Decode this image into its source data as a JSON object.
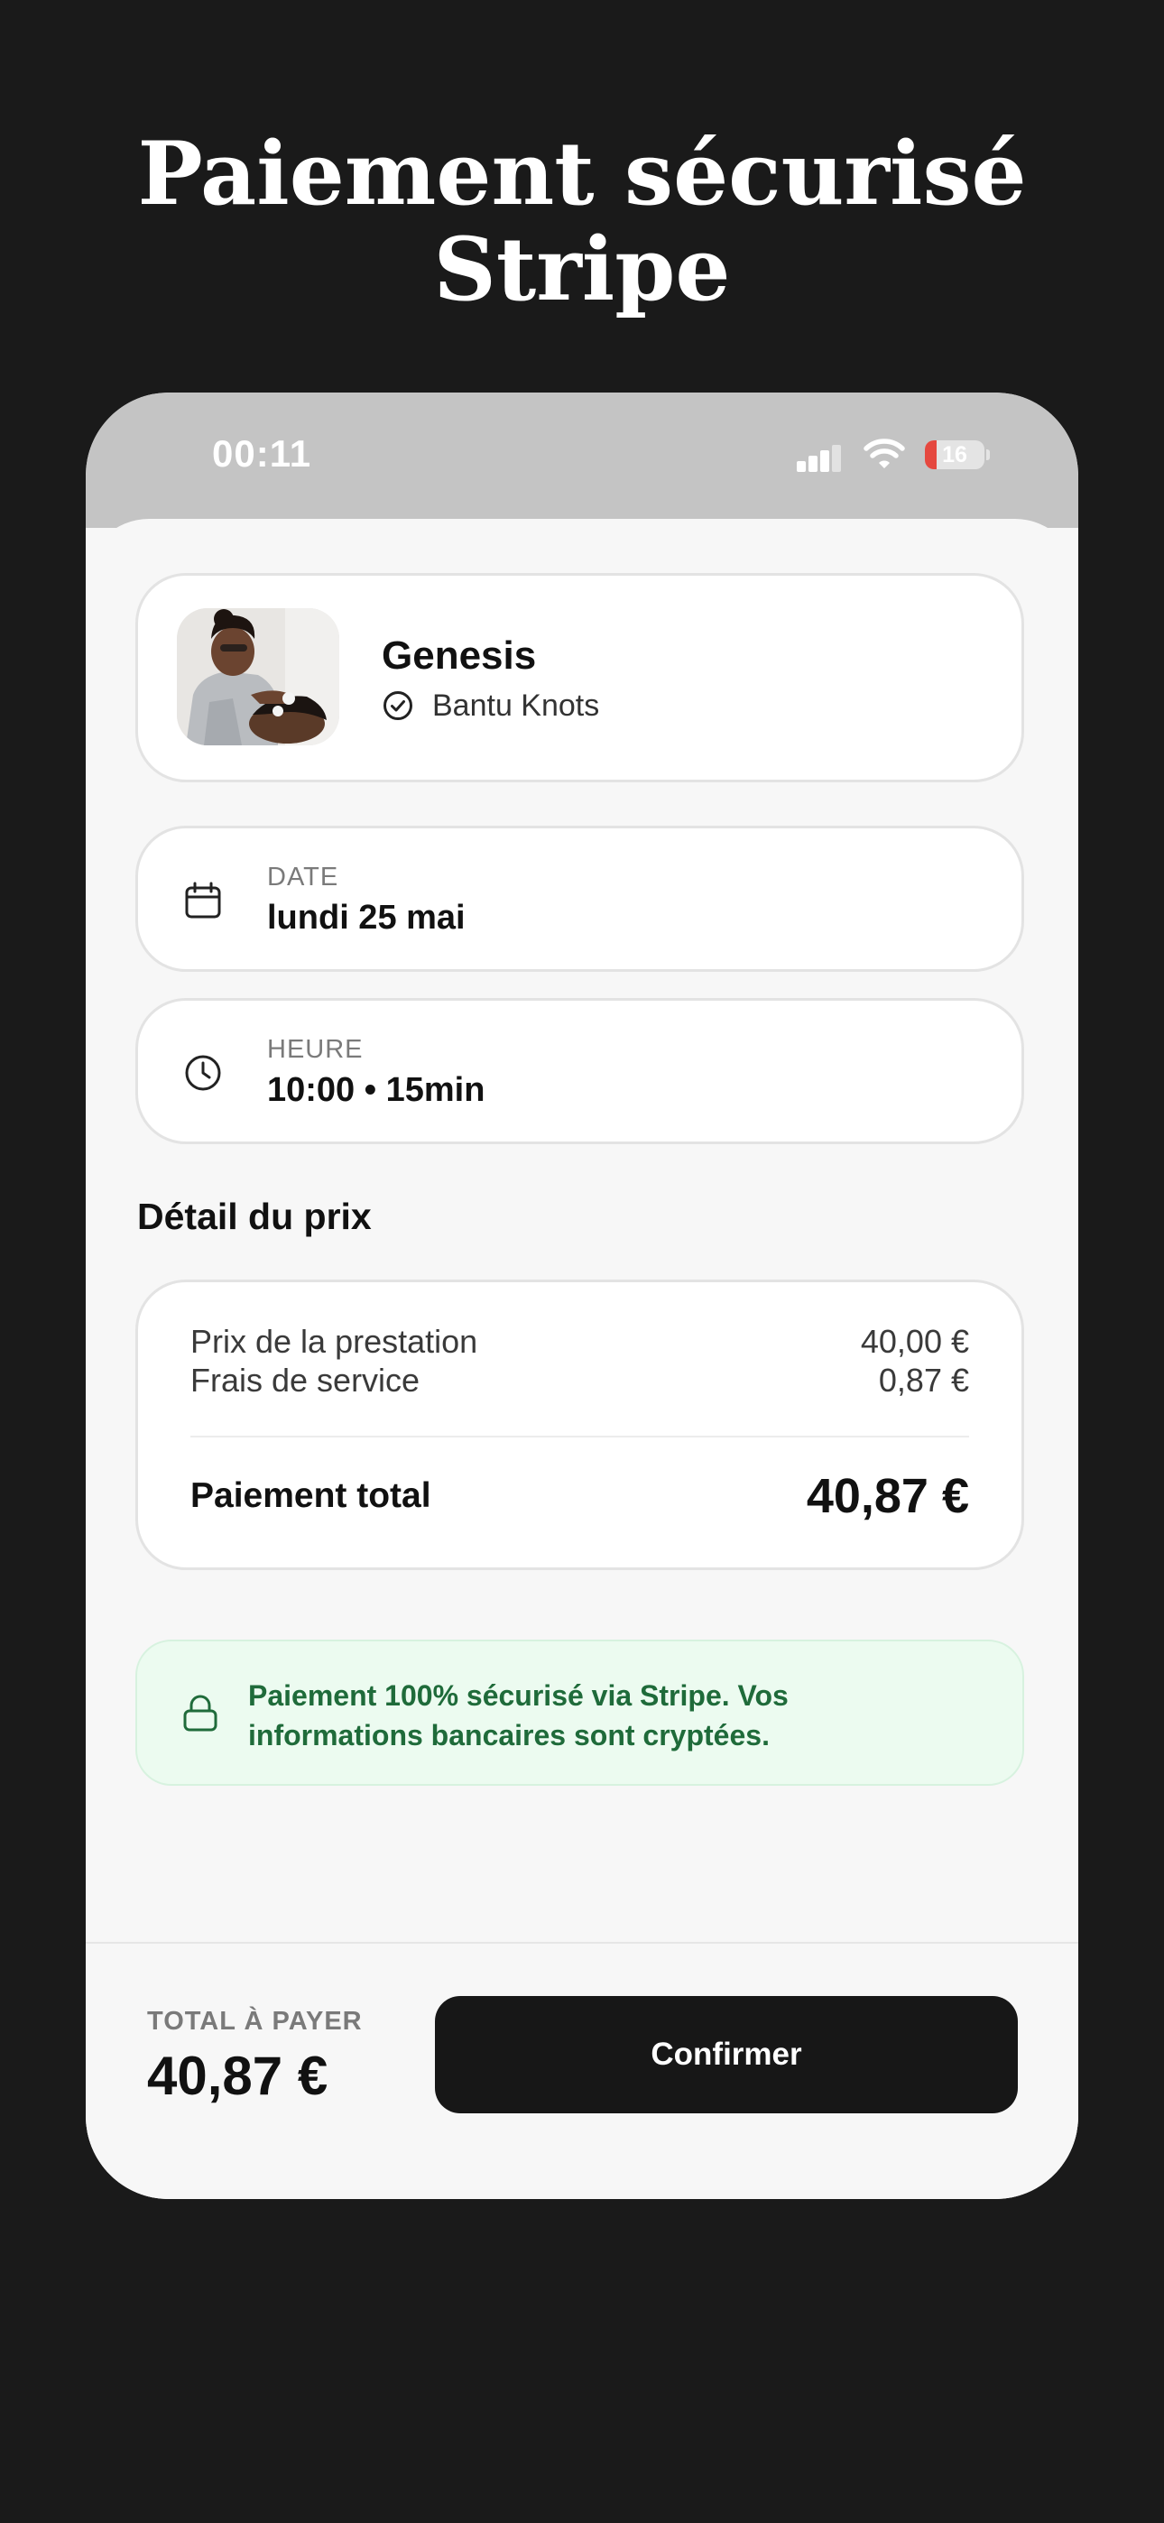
{
  "headline": {
    "line1": "Paiement sécurisé",
    "line2": "Stripe"
  },
  "status_bar": {
    "time": "00:11",
    "battery": "16",
    "icons": [
      "signal-icon",
      "wifi-icon",
      "battery-icon"
    ]
  },
  "provider": {
    "name": "Genesis",
    "service": "Bantu Knots",
    "service_icon": "check-circle-icon",
    "avatar": "provider-photo"
  },
  "date": {
    "icon": "calendar-icon",
    "label": "DATE",
    "value": "lundi 25 mai"
  },
  "time_slot": {
    "icon": "clock-icon",
    "label": "HEURE",
    "value": "10:00 • 15min"
  },
  "price_detail": {
    "title": "Détail du prix",
    "rows": [
      {
        "label": "Prix de la prestation",
        "value": "40,00 €"
      },
      {
        "label": "Frais de service",
        "value": "0,87 €"
      }
    ],
    "total_label": "Paiement total",
    "total_value": "40,87 €"
  },
  "security_notice": {
    "icon": "lock-icon",
    "text": "Paiement 100% sécurisé via Stripe. Vos informations bancaires sont cryptées.",
    "color": "#1f6b3a",
    "background": "#ecfbf0"
  },
  "footer": {
    "total_label": "TOTAL À PAYER",
    "total_value": "40,87 €",
    "confirm_label": "Confirmer"
  },
  "colors": {
    "background": "#1a1a1a",
    "sheet": "#f7f7f7",
    "button": "#171717",
    "battery_low": "#e5483f"
  }
}
